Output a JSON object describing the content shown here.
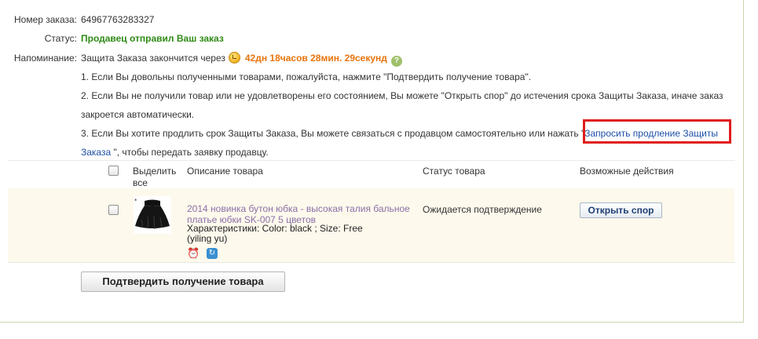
{
  "order": {
    "number_label": "Номер заказа:",
    "number_value": "64967763283327",
    "status_label": "Статус:",
    "status_value": "Продавец отправил Ваш заказ",
    "reminder_label": "Напоминание:",
    "reminder_text": "Защита Заказа закончится через",
    "reminder_timer": "42дн 18часов 28мин. 29секунд",
    "help_icon_text": "?"
  },
  "notes": {
    "line1": "1. Если Вы довольны полученными товарами, пожалуйста, нажмите \"Подтвердить получение товара\".",
    "line2": "2. Если Вы не получили товар или не удовлетворены его состоянием, Вы можете \"Открыть спор\" до истечения срока Защиты Заказа, иначе заказ",
    "line2b": "закроется автоматически.",
    "line3": "3. Если Вы хотите продлить срок Защиты Заказа, Вы можете связаться с продавцом самостоятельно или нажать \"",
    "link_part1": "Запросить продление Защиты",
    "link_part2": "Заказа",
    "line3_end": " \", чтобы передать заявку продавцу."
  },
  "table": {
    "headers": {
      "select_all_line1": "Выделить",
      "select_all_line2": "все",
      "description": "Описание товара",
      "status": "Статус товара",
      "actions": "Возможные действия"
    },
    "rows": [
      {
        "title_line1": "2014 новинка бутон юбка - высокая талия бальное",
        "title_line2": "платье юбки SK-007 5 цветов",
        "attrs_line1": "Характеристики: Color: black   ; Size: Free",
        "attrs_line2": "(yiling yu)",
        "status": "Ожидается подтверждение",
        "action_button": "Открыть спор"
      }
    ]
  },
  "buttons": {
    "confirm": "Подтвердить получение товара"
  },
  "colors": {
    "status_green": "#2f8a16",
    "timer_orange": "#e8740c",
    "link_blue": "#1f4fa8",
    "highlight_red": "#e01d1d",
    "row_background": "#fdf9ec"
  }
}
